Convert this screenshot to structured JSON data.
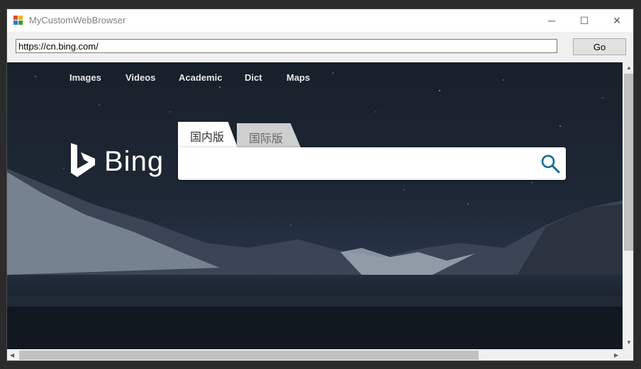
{
  "window": {
    "title": "MyCustomWebBrowser",
    "minimize": "─",
    "maximize": "☐",
    "close": "✕"
  },
  "toolbar": {
    "url": "https://cn.bing.com/",
    "go_label": "Go"
  },
  "bing": {
    "nav": [
      "Images",
      "Videos",
      "Academic",
      "Dict",
      "Maps"
    ],
    "logo_text": "Bing",
    "tabs": [
      "国内版",
      "国际版"
    ],
    "search_value": ""
  },
  "scroll": {
    "up": "▲",
    "down": "▼",
    "left": "◀",
    "right": "▶"
  }
}
